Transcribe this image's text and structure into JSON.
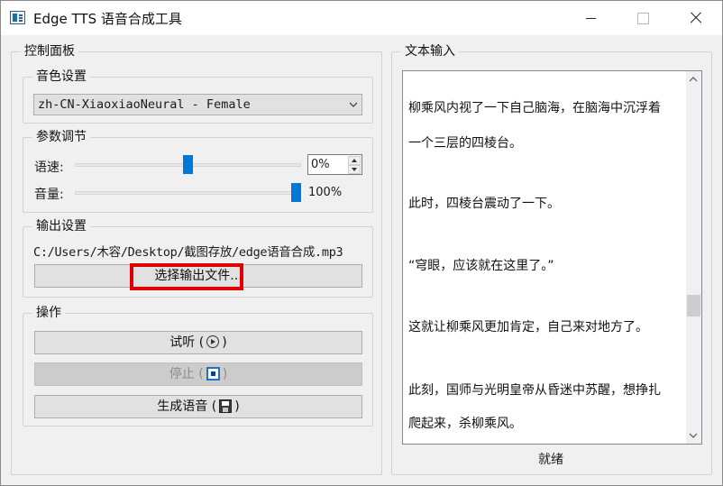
{
  "window": {
    "title": "Edge TTS 语音合成工具"
  },
  "control_panel": {
    "title": "控制面板",
    "voice": {
      "title": "音色设置",
      "selected": "zh-CN-XiaoxiaoNeural - Female"
    },
    "params": {
      "title": "参数调节",
      "rate_label": "语速:",
      "rate_value": "0%",
      "rate_level": 0.5,
      "volume_label": "音量:",
      "volume_value": "100%",
      "volume_level": 1.0
    },
    "output": {
      "title": "输出设置",
      "path": "C:/Users/木容/Desktop/截图存放/edge语音合成.mp3",
      "select_button": "选择输出文件..."
    },
    "actions": {
      "title": "操作",
      "preview_label": "试听",
      "stop_label": "停止",
      "generate_label": "生成语音"
    }
  },
  "text_input": {
    "title": "文本输入",
    "paragraphs": [
      "柳乘风内视了一下自己脑海，在脑海中沉浮着",
      "一个三层的四棱台。",
      "此时，四棱台震动了一下。",
      "“穹眼，应该就在这里了。”",
      "这就让柳乘风更加肯定，自己来对地方了。",
      "此刻，国师与光明皇帝从昏迷中苏醒，想挣扎",
      "爬起来，杀柳乘风。"
    ]
  },
  "status": {
    "text": "就绪"
  },
  "colors": {
    "accent": "#0078d7",
    "highlight": "#e00000"
  }
}
